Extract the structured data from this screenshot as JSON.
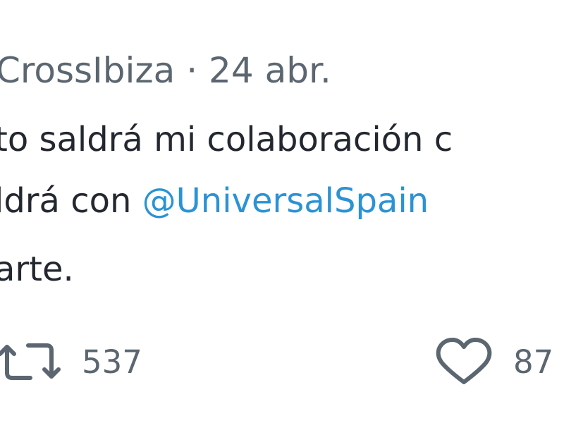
{
  "tweet": {
    "author_handle": "CrossIbiza",
    "separator": "·",
    "date": "24 abr.",
    "lines": [
      {
        "text": "to saldrá mi colaboración c"
      },
      {
        "before": "ldrá con ",
        "mention": "@UniversalSpain"
      },
      {
        "text": "arte."
      }
    ],
    "actions": {
      "retweet": {
        "icon": "retweet-icon",
        "count": "537"
      },
      "like": {
        "icon": "heart-icon",
        "count": "87"
      }
    },
    "colors": {
      "text": "#232830",
      "secondary": "#5b6670",
      "mention": "#2a93d5",
      "background": "#ffffff"
    }
  }
}
